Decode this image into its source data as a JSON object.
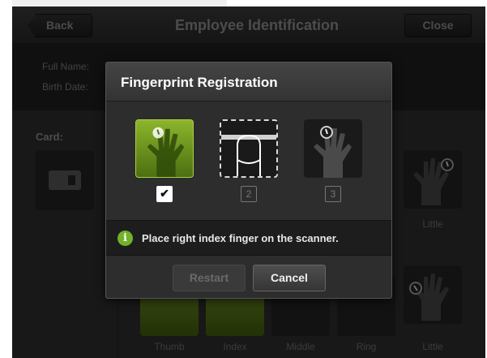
{
  "header": {
    "back_label": "Back",
    "title": "Employee Identification",
    "close_label": "Close"
  },
  "info": {
    "full_name_label": "Full Name:",
    "birth_date_label": "Birth Date:"
  },
  "card": {
    "label": "Card:"
  },
  "fingers": {
    "labels": [
      "Thumb",
      "Index",
      "Middle",
      "Ring",
      "Little"
    ],
    "upper_label": "Little"
  },
  "dialog": {
    "title": "Fingerprint Registration",
    "steps": [
      {
        "marker": "✔",
        "state": "done"
      },
      {
        "marker": "2",
        "state": "active"
      },
      {
        "marker": "3",
        "state": "pending"
      }
    ],
    "message": "Place right index finger on the scanner.",
    "restart_label": "Restart",
    "cancel_label": "Cancel"
  },
  "colors": {
    "accent_green": "#73b12b",
    "background": "#2a2a2a"
  }
}
